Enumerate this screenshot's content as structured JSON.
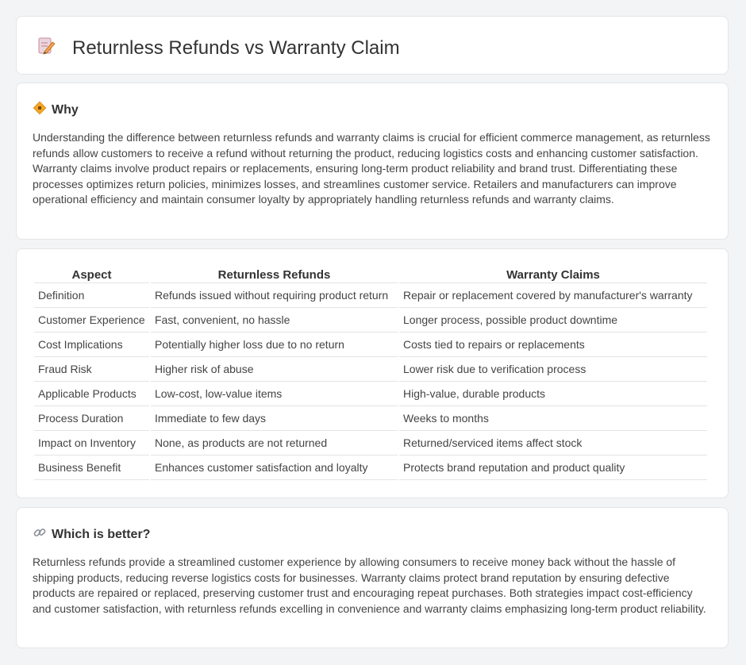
{
  "page": {
    "title": "Returnless Refunds vs Warranty Claim"
  },
  "why": {
    "heading": "Why",
    "text": "Understanding the difference between returnless refunds and warranty claims is crucial for efficient commerce management, as returnless refunds allow customers to receive a refund without returning the product, reducing logistics costs and enhancing customer satisfaction. Warranty claims involve product repairs or replacements, ensuring long-term product reliability and brand trust. Differentiating these processes optimizes return policies, minimizes losses, and streamlines customer service. Retailers and manufacturers can improve operational efficiency and maintain consumer loyalty by appropriately handling returnless refunds and warranty claims."
  },
  "table": {
    "headers": [
      "Aspect",
      "Returnless Refunds",
      "Warranty Claims"
    ],
    "rows": [
      [
        "Definition",
        "Refunds issued without requiring product return",
        "Repair or replacement covered by manufacturer's warranty"
      ],
      [
        "Customer Experience",
        "Fast, convenient, no hassle",
        "Longer process, possible product downtime"
      ],
      [
        "Cost Implications",
        "Potentially higher loss due to no return",
        "Costs tied to repairs or replacements"
      ],
      [
        "Fraud Risk",
        "Higher risk of abuse",
        "Lower risk due to verification process"
      ],
      [
        "Applicable Products",
        "Low-cost, low-value items",
        "High-value, durable products"
      ],
      [
        "Process Duration",
        "Immediate to few days",
        "Weeks to months"
      ],
      [
        "Impact on Inventory",
        "None, as products are not returned",
        "Returned/serviced items affect stock"
      ],
      [
        "Business Benefit",
        "Enhances customer satisfaction and loyalty",
        "Protects brand reputation and product quality"
      ]
    ]
  },
  "better": {
    "heading": "Which is better?",
    "text": "Returnless refunds provide a streamlined customer experience by allowing consumers to receive money back without the hassle of shipping products, reducing reverse logistics costs for businesses. Warranty claims protect brand reputation by ensuring defective products are repaired or replaced, preserving customer trust and encouraging repeat purchases. Both strategies impact cost-efficiency and customer satisfaction, with returnless refunds excelling in convenience and warranty claims emphasizing long-term product reliability."
  },
  "icons": {
    "title_icon": "document-pencil-icon",
    "why_icon": "diamond-sign-icon",
    "better_icon": "link-icon"
  },
  "colors": {
    "accent": "#f5a623",
    "icon_doc": "#d9534f"
  }
}
